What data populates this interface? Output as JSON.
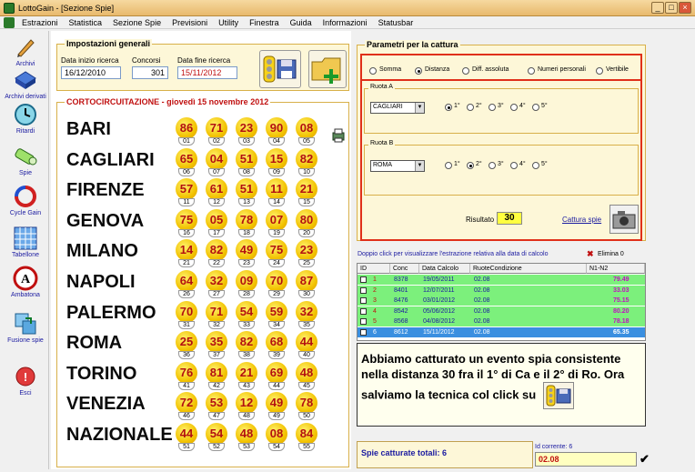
{
  "window": {
    "title": "LottoGain - [Sezione Spie]",
    "min": "_",
    "max": "□",
    "close": "×"
  },
  "menu": [
    "Estrazioni",
    "Statistica",
    "Sezione Spie",
    "Previsioni",
    "Utility",
    "Finestra",
    "Guida",
    "Informazioni",
    "Statusbar"
  ],
  "sidebar": [
    {
      "label": "Archivi",
      "icon": "pencil-icon"
    },
    {
      "label": "Archivi derivati",
      "icon": "disk-icon"
    },
    {
      "label": "Ritardi",
      "icon": "clock-icon"
    },
    {
      "label": "Spie",
      "icon": "spyglass-icon"
    },
    {
      "label": "Cycle Gain",
      "icon": "cycle-icon"
    },
    {
      "label": "Tabellone",
      "icon": "grid-icon"
    },
    {
      "label": "Ambatona",
      "icon": "letter-a-icon"
    },
    {
      "label": "Fusione spie",
      "icon": "merge-icon"
    },
    {
      "label": "Esci",
      "icon": "exit-icon"
    }
  ],
  "settings": {
    "title": "Impostazioni generali",
    "start_label": "Data inizio ricerca",
    "start_value": "16/12/2010",
    "contests_label": "Concorsi",
    "contests_value": "301",
    "end_label": "Data fine ricerca",
    "end_value": "15/11/2012"
  },
  "draw": {
    "title": "CORTOCIRCUITAZIONE - giovedì 15 novembre 2012",
    "wheels": [
      {
        "name": "BARI",
        "numbers": [
          "86",
          "71",
          "23",
          "90",
          "08"
        ],
        "pos": [
          "01",
          "02",
          "03",
          "04",
          "05"
        ]
      },
      {
        "name": "CAGLIARI",
        "numbers": [
          "65",
          "04",
          "51",
          "15",
          "82"
        ],
        "pos": [
          "06",
          "07",
          "08",
          "09",
          "10"
        ]
      },
      {
        "name": "FIRENZE",
        "numbers": [
          "57",
          "61",
          "51",
          "11",
          "21"
        ],
        "pos": [
          "11",
          "12",
          "13",
          "14",
          "15"
        ]
      },
      {
        "name": "GENOVA",
        "numbers": [
          "75",
          "05",
          "78",
          "07",
          "80"
        ],
        "pos": [
          "16",
          "17",
          "18",
          "19",
          "20"
        ]
      },
      {
        "name": "MILANO",
        "numbers": [
          "14",
          "82",
          "49",
          "75",
          "23"
        ],
        "pos": [
          "21",
          "22",
          "23",
          "24",
          "25"
        ]
      },
      {
        "name": "NAPOLI",
        "numbers": [
          "64",
          "32",
          "09",
          "70",
          "87"
        ],
        "pos": [
          "26",
          "27",
          "28",
          "29",
          "30"
        ]
      },
      {
        "name": "PALERMO",
        "numbers": [
          "70",
          "71",
          "54",
          "59",
          "32"
        ],
        "pos": [
          "31",
          "32",
          "33",
          "34",
          "35"
        ]
      },
      {
        "name": "ROMA",
        "numbers": [
          "25",
          "35",
          "82",
          "68",
          "44"
        ],
        "pos": [
          "36",
          "37",
          "38",
          "39",
          "40"
        ]
      },
      {
        "name": "TORINO",
        "numbers": [
          "76",
          "81",
          "21",
          "69",
          "48"
        ],
        "pos": [
          "41",
          "42",
          "43",
          "44",
          "45"
        ]
      },
      {
        "name": "VENEZIA",
        "numbers": [
          "72",
          "53",
          "12",
          "49",
          "78"
        ],
        "pos": [
          "46",
          "47",
          "48",
          "49",
          "50"
        ]
      },
      {
        "name": "NAZIONALE",
        "numbers": [
          "44",
          "54",
          "48",
          "08",
          "84"
        ],
        "pos": [
          "51",
          "52",
          "53",
          "54",
          "55"
        ]
      }
    ]
  },
  "params": {
    "title": "Parametri per la cattura",
    "modes": [
      "Somma",
      "Distanza",
      "Diff. assoluta",
      "Numeri personali",
      "Vertibile"
    ],
    "mode_selected": "Distanza",
    "ruota_a": {
      "label": "Ruota A",
      "value": "CAGLIARI",
      "positions": [
        "1°",
        "2°",
        "3°",
        "4°",
        "5°"
      ],
      "selected": "1°"
    },
    "ruota_b": {
      "label": "Ruota B",
      "value": "ROMA",
      "positions": [
        "1°",
        "2°",
        "3°",
        "4°",
        "5°"
      ],
      "selected": "2°"
    },
    "result_label": "Risultato",
    "result_value": "30",
    "capture_label": "Cattura spie"
  },
  "table": {
    "hint": "Doppio click per visualizzare l'estrazione relativa alla data di calcolo",
    "delete_label": "Elimina 0",
    "columns": [
      "ID",
      "Conc",
      "Data Calcolo",
      "RuoteCondizione",
      "N1-N2"
    ],
    "rows": [
      {
        "id": "1",
        "conc": "8378",
        "date": "19/05/2011",
        "cond": "02.08",
        "n": "79.49"
      },
      {
        "id": "2",
        "conc": "8401",
        "date": "12/07/2011",
        "cond": "02.08",
        "n": "33.03"
      },
      {
        "id": "3",
        "conc": "8476",
        "date": "03/01/2012",
        "cond": "02.08",
        "n": "75.15"
      },
      {
        "id": "4",
        "conc": "8542",
        "date": "05/06/2012",
        "cond": "02.08",
        "n": "80.20"
      },
      {
        "id": "5",
        "conc": "8568",
        "date": "04/08/2012",
        "cond": "02.08",
        "n": "78.18"
      },
      {
        "id": "6",
        "conc": "8612",
        "date": "15/11/2012",
        "cond": "02.08",
        "n": "65.35"
      }
    ]
  },
  "popup": {
    "text": "Abbiamo catturato un evento spia consistente nella distanza 30 fra il 1° di Ca e il 2° di Ro. Ora salviamo la tecnica col click su"
  },
  "footer": {
    "captured_label": "Spie catturate totali: 6",
    "current_label": "Id corrente: 6",
    "current_value": "02.08"
  },
  "colors": {
    "row_green": "#7cf07c",
    "row_selected": "#3a8fe0",
    "red_frame": "#e0301a",
    "ball": "#f2c200"
  }
}
